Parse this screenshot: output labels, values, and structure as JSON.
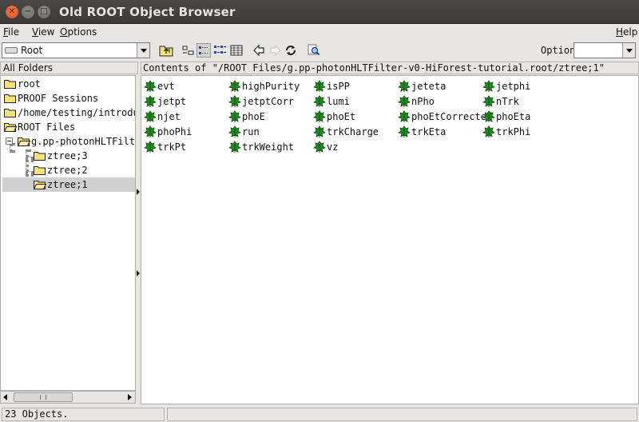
{
  "window": {
    "title": "Old ROOT Object Browser",
    "close": "✕",
    "minimize": "−",
    "maximize": "□"
  },
  "menu": [
    {
      "label": "File",
      "u": "F",
      "rest": "ile"
    },
    {
      "label": "View",
      "u": "V",
      "rest": "iew"
    },
    {
      "label": "Options",
      "u": "O",
      "rest": "ptions"
    }
  ],
  "help_menu": {
    "u": "H",
    "rest": "elp"
  },
  "toolbar": {
    "location": "Root",
    "option_label": "Option",
    "option_value": ""
  },
  "left_panel": {
    "header": "All Folders",
    "tree": [
      {
        "label": "root"
      },
      {
        "label": "PROOF Sessions"
      },
      {
        "label": "/home/testing/introductio"
      },
      {
        "label": "ROOT Files"
      },
      {
        "label": "g.pp-photonHLTFilter-v"
      },
      {
        "label": "ztree;3"
      },
      {
        "label": "ztree;2"
      },
      {
        "label": "ztree;1"
      }
    ]
  },
  "right_panel": {
    "header": "Contents of \"/ROOT Files/g.pp-photonHLTFilter-v0-HiForest-tutorial.root/ztree;1\"",
    "leaves": [
      [
        "evt",
        "highPurity",
        "isPP",
        "jeteta",
        "jetphi"
      ],
      [
        "jetpt",
        "jetptCorr",
        "lumi",
        "nPho",
        "nTrk"
      ],
      [
        "njet",
        "phoE",
        "phoEt",
        "phoEtCorrected",
        "phoEta"
      ],
      [
        "phoPhi",
        "run",
        "trkCharge",
        "trkEta",
        "trkPhi"
      ],
      [
        "trkPt",
        "trkWeight",
        "vz"
      ]
    ]
  },
  "status": {
    "text": "23 Objects."
  },
  "colors": {
    "leaf_green": "#1f8a1f",
    "folder_yellow": "#f2e27a"
  }
}
